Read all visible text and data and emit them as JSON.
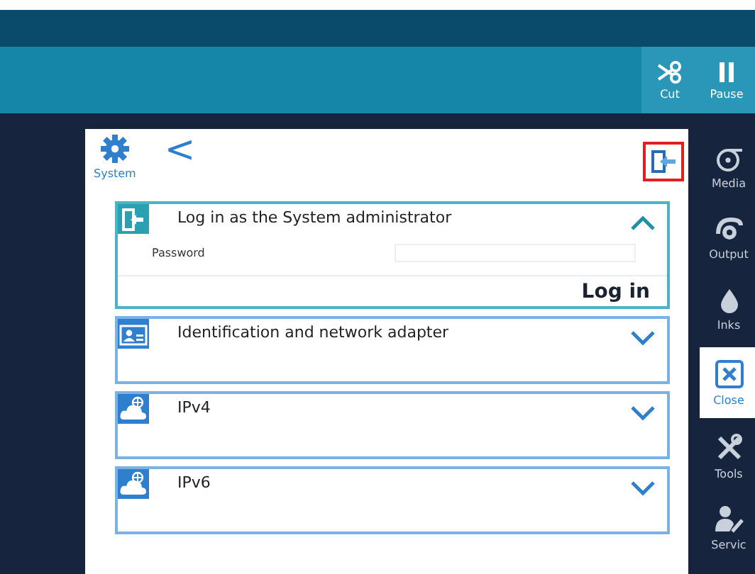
{
  "toolbar": {
    "buttons": [
      {
        "label": "Cut",
        "kind": "cut"
      },
      {
        "label": "Pause",
        "kind": "pause"
      }
    ]
  },
  "panel": {
    "title": "System",
    "back": "<",
    "sections": [
      {
        "title": "Log in as the System administrator",
        "kind": "login",
        "expanded": true,
        "field_label": "Password",
        "action": "Log in"
      },
      {
        "title": "Identification and network adapter",
        "kind": "id",
        "expanded": false
      },
      {
        "title": "IPv4",
        "kind": "cloud",
        "expanded": false
      },
      {
        "title": "IPv6",
        "kind": "cloud",
        "expanded": false
      }
    ]
  },
  "sidebar": {
    "items": [
      {
        "label": "Media",
        "kind": "media",
        "selected": false
      },
      {
        "label": "Output",
        "kind": "output",
        "selected": false
      },
      {
        "label": "Inks",
        "kind": "inks",
        "selected": false
      },
      {
        "label": "Close",
        "kind": "close",
        "selected": true
      },
      {
        "label": "Tools",
        "kind": "tools",
        "selected": false
      },
      {
        "label": "Servic",
        "kind": "service",
        "selected": false
      }
    ]
  }
}
